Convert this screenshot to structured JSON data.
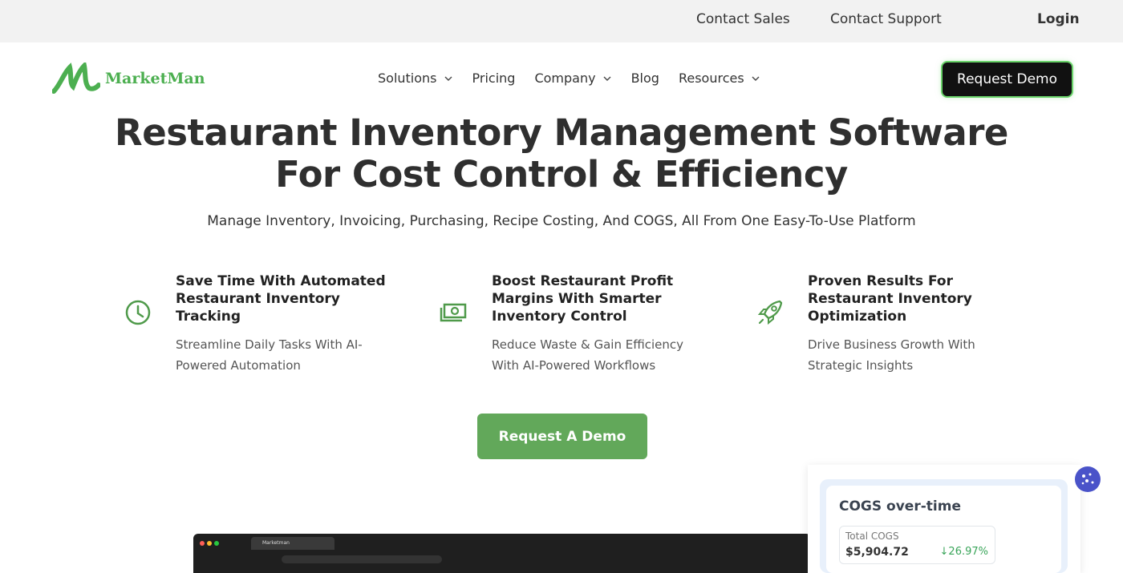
{
  "topbar": {
    "contact_sales": "Contact Sales",
    "contact_support": "Contact Support",
    "login": "Login"
  },
  "brand": {
    "name": "MarketMan",
    "color": "#4caf50"
  },
  "nav": {
    "solutions": "Solutions",
    "pricing": "Pricing",
    "company": "Company",
    "blog": "Blog",
    "resources": "Resources"
  },
  "header": {
    "request_demo": "Request Demo"
  },
  "hero": {
    "title_line1": "Restaurant Inventory Management Software",
    "title_line2": "For Cost Control & Efficiency",
    "subtitle": "Manage Inventory, Invoicing, Purchasing, Recipe Costing, And COGS, All From One Easy-To-Use Platform"
  },
  "features": [
    {
      "icon": "clock-icon",
      "title": "Save Time With Automated Restaurant Inventory Tracking",
      "desc": "Streamline Daily Tasks With AI-Powered Automation"
    },
    {
      "icon": "money-icon",
      "title": "Boost Restaurant Profit Margins With Smarter Inventory Control",
      "desc": "Reduce Waste & Gain Efficiency With AI-Powered Workflows"
    },
    {
      "icon": "rocket-icon",
      "title": "Proven Results For Restaurant Inventory Optimization",
      "desc": "Drive Business Growth With Strategic Insights"
    }
  ],
  "cta": {
    "label": "Request A Demo",
    "color": "#62a85a"
  },
  "browser_preview": {
    "tab_label": "Marketman"
  },
  "cogs_card": {
    "title": "COGS over-time",
    "stat_label": "Total COGS",
    "stat_value": "$5,904.72",
    "stat_change": "↓26.97%"
  }
}
